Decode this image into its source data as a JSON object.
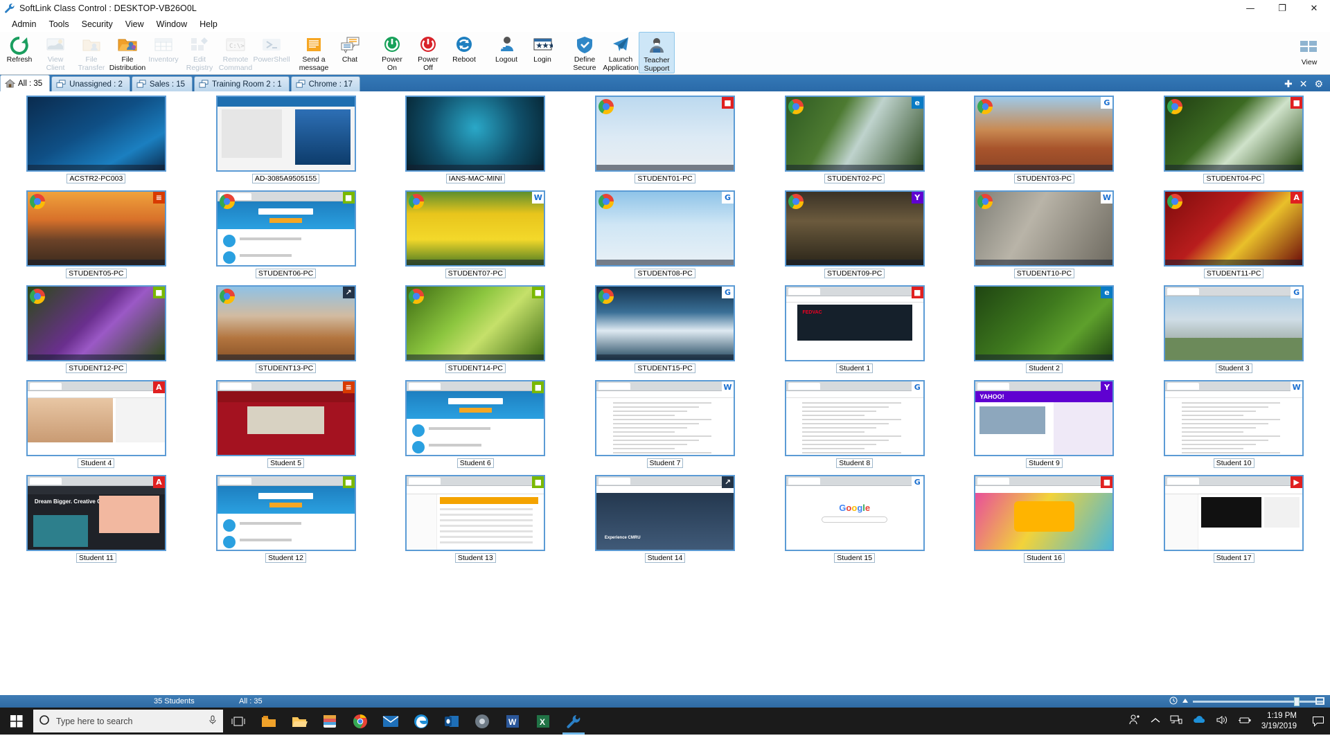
{
  "window": {
    "title": "SoftLink Class Control : DESKTOP-VB26O0L",
    "icon": "wrench-icon",
    "minimize": "—",
    "maximize": "❐",
    "close": "✕"
  },
  "menu": [
    "Admin",
    "Tools",
    "Security",
    "View",
    "Window",
    "Help"
  ],
  "toolbar": {
    "buttons": [
      {
        "line1": "Refresh",
        "line2": "",
        "icon": "refresh-icon",
        "enabled": true,
        "selected": false
      },
      {
        "line1": "View",
        "line2": "Client",
        "icon": "view-client-icon",
        "enabled": false,
        "selected": false
      },
      {
        "line1": "File",
        "line2": "Transfer",
        "icon": "file-transfer-icon",
        "enabled": false,
        "selected": false
      },
      {
        "line1": "File",
        "line2": "Distribution",
        "icon": "file-distribution-icon",
        "enabled": true,
        "selected": false
      },
      {
        "line1": "Inventory",
        "line2": "",
        "icon": "inventory-icon",
        "enabled": false,
        "selected": false
      },
      {
        "line1": "Edit",
        "line2": "Registry",
        "icon": "edit-registry-icon",
        "enabled": false,
        "selected": false
      },
      {
        "line1": "Remote",
        "line2": "Command",
        "icon": "remote-command-icon",
        "enabled": false,
        "selected": false
      },
      {
        "line1": "PowerShell",
        "line2": "",
        "icon": "powershell-icon",
        "enabled": false,
        "selected": false
      },
      {
        "line1": "Send a",
        "line2": "message",
        "icon": "send-message-icon",
        "enabled": true,
        "selected": false
      },
      {
        "line1": "Chat",
        "line2": "",
        "icon": "chat-icon",
        "enabled": true,
        "selected": false
      },
      {
        "line1": "Power",
        "line2": "On",
        "icon": "power-on-icon",
        "enabled": true,
        "selected": false
      },
      {
        "line1": "Power",
        "line2": "Off",
        "icon": "power-off-icon",
        "enabled": true,
        "selected": false
      },
      {
        "line1": "Reboot",
        "line2": "",
        "icon": "reboot-icon",
        "enabled": true,
        "selected": false
      },
      {
        "line1": "Logout",
        "line2": "",
        "icon": "logout-icon",
        "enabled": true,
        "selected": false
      },
      {
        "line1": "Login",
        "line2": "",
        "icon": "login-icon",
        "enabled": true,
        "selected": false
      },
      {
        "line1": "Define",
        "line2": "Secure",
        "icon": "define-secure-icon",
        "enabled": true,
        "selected": false
      },
      {
        "line1": "Launch",
        "line2": "Application",
        "icon": "launch-application-icon",
        "enabled": true,
        "selected": false
      },
      {
        "line1": "Teacher",
        "line2": "Support",
        "icon": "teacher-support-icon",
        "enabled": true,
        "selected": true
      }
    ],
    "right_button": {
      "label": "View",
      "icon": "view-layout-icon"
    }
  },
  "tabs": [
    {
      "label": "All : 35",
      "icon": "home-icon",
      "active": true
    },
    {
      "label": "Unassigned : 2",
      "icon": "group-icon",
      "active": false
    },
    {
      "label": "Sales : 15",
      "icon": "group-icon",
      "active": false
    },
    {
      "label": "Training Room 2 : 1",
      "icon": "group-icon",
      "active": false
    },
    {
      "label": "Chrome : 17",
      "icon": "group-icon",
      "active": false
    }
  ],
  "tab_actions": [
    {
      "name": "add-tab-button",
      "glyph": "✚"
    },
    {
      "name": "close-tab-button",
      "glyph": "✕"
    },
    {
      "name": "tab-settings-button",
      "glyph": "⚙"
    }
  ],
  "clients": [
    {
      "name": "ACSTR2-PC003",
      "app": "none",
      "badge": "none",
      "scene": "win10"
    },
    {
      "name": "AD-3085A9505155",
      "app": "none",
      "badge": "none",
      "scene": "phone"
    },
    {
      "name": "IANS-MAC-MINI",
      "app": "none",
      "badge": "none",
      "scene": "mac"
    },
    {
      "name": "STUDENT01-PC",
      "app": "chrome",
      "badge": "red",
      "scene": "arch"
    },
    {
      "name": "STUDENT02-PC",
      "app": "chrome",
      "badge": "edge",
      "scene": "waterfall"
    },
    {
      "name": "STUDENT03-PC",
      "app": "chrome",
      "badge": "google",
      "scene": "desert"
    },
    {
      "name": "STUDENT04-PC",
      "app": "chrome",
      "badge": "red",
      "scene": "hydrangea"
    },
    {
      "name": "STUDENT05-PC",
      "app": "chrome",
      "badge": "excel",
      "scene": "sunset"
    },
    {
      "name": "STUDENT06-PC",
      "app": "chrome",
      "badge": "green",
      "scene": "webpage-blue"
    },
    {
      "name": "STUDENT07-PC",
      "app": "chrome",
      "badge": "word",
      "scene": "tulips"
    },
    {
      "name": "STUDENT08-PC",
      "app": "chrome",
      "badge": "google",
      "scene": "penguins"
    },
    {
      "name": "STUDENT09-PC",
      "app": "chrome",
      "badge": "yahoo",
      "scene": "castle"
    },
    {
      "name": "STUDENT10-PC",
      "app": "chrome",
      "badge": "word",
      "scene": "koala"
    },
    {
      "name": "STUDENT11-PC",
      "app": "chrome",
      "badge": "adobe",
      "scene": "leaves"
    },
    {
      "name": "STUDENT12-PC",
      "app": "chrome",
      "badge": "green",
      "scene": "thistle"
    },
    {
      "name": "STUDENT13-PC",
      "app": "chrome",
      "badge": "dark",
      "scene": "arch-rock"
    },
    {
      "name": "STUDENT14-PC",
      "app": "chrome",
      "badge": "green",
      "scene": "grapes"
    },
    {
      "name": "STUDENT15-PC",
      "app": "chrome",
      "badge": "google",
      "scene": "ice"
    },
    {
      "name": "Student 1",
      "app": "none",
      "badge": "red",
      "scene": "site-dark"
    },
    {
      "name": "Student 2",
      "app": "none",
      "badge": "edge",
      "scene": "cactus"
    },
    {
      "name": "Student 3",
      "app": "none",
      "badge": "google",
      "scene": "houses"
    },
    {
      "name": "Student 4",
      "app": "none",
      "badge": "adobe",
      "scene": "family"
    },
    {
      "name": "Student 5",
      "app": "none",
      "badge": "excel",
      "scene": "news-red"
    },
    {
      "name": "Student 6",
      "app": "none",
      "badge": "green",
      "scene": "webpage-blue"
    },
    {
      "name": "Student 7",
      "app": "none",
      "badge": "word",
      "scene": "wiki"
    },
    {
      "name": "Student 8",
      "app": "none",
      "badge": "google",
      "scene": "docpage"
    },
    {
      "name": "Student 9",
      "app": "none",
      "badge": "yahoo",
      "scene": "yahoo"
    },
    {
      "name": "Student 10",
      "app": "none",
      "badge": "word",
      "scene": "wiki2"
    },
    {
      "name": "Student 11",
      "app": "none",
      "badge": "adobe",
      "scene": "adobe"
    },
    {
      "name": "Student 12",
      "app": "none",
      "badge": "green",
      "scene": "webpage-blue"
    },
    {
      "name": "Student 13",
      "app": "none",
      "badge": "green",
      "scene": "shop"
    },
    {
      "name": "Student 14",
      "app": "none",
      "badge": "dark",
      "scene": "crowd"
    },
    {
      "name": "Student 15",
      "app": "none",
      "badge": "google",
      "scene": "google"
    },
    {
      "name": "Student 16",
      "app": "none",
      "badge": "red",
      "scene": "kids"
    },
    {
      "name": "Student 17",
      "app": "none",
      "badge": "youtube",
      "scene": "youtube"
    }
  ],
  "status": {
    "students": "35 Students",
    "selection": "All : 35",
    "clock_icon": "clock-icon",
    "up_icon": "triangle-up-icon",
    "zoom_pause_icon": "pause-icon",
    "zoom_max_icon": "maximize-icon"
  },
  "taskbar": {
    "start_icon": "windows-start-icon",
    "search_placeholder": "Type here to search",
    "search_icon": "search-circle-icon",
    "mic_icon": "microphone-icon",
    "taskview_icon": "task-view-icon",
    "apps": [
      {
        "name": "explorer-pinned-icon",
        "label": "Explorer"
      },
      {
        "name": "folder-icon",
        "label": "File Explorer"
      },
      {
        "name": "store-icon",
        "label": "Microsoft Store"
      },
      {
        "name": "chrome-icon",
        "label": "Google Chrome"
      },
      {
        "name": "mail-icon",
        "label": "Mail"
      },
      {
        "name": "edge-icon",
        "label": "Microsoft Edge"
      },
      {
        "name": "outlook-icon",
        "label": "Outlook"
      },
      {
        "name": "media-icon",
        "label": "Media Player"
      },
      {
        "name": "word-icon",
        "label": "Word"
      },
      {
        "name": "excel-icon",
        "label": "Excel"
      },
      {
        "name": "softlink-icon",
        "label": "SoftLink Class Control"
      }
    ],
    "tray": [
      {
        "name": "people-icon"
      },
      {
        "name": "show-hidden-icons-icon"
      },
      {
        "name": "network-icon"
      },
      {
        "name": "onedrive-icon"
      },
      {
        "name": "volume-icon"
      },
      {
        "name": "battery-icon"
      }
    ],
    "time": "1:19 PM",
    "date": "3/19/2019",
    "action_center_icon": "action-center-icon"
  },
  "colors": {
    "accent": "#2f6ba4",
    "tab_active": "#ffffff",
    "thumb_border": "#5b9bd5",
    "toolbar_selected": "#cde6f7"
  }
}
